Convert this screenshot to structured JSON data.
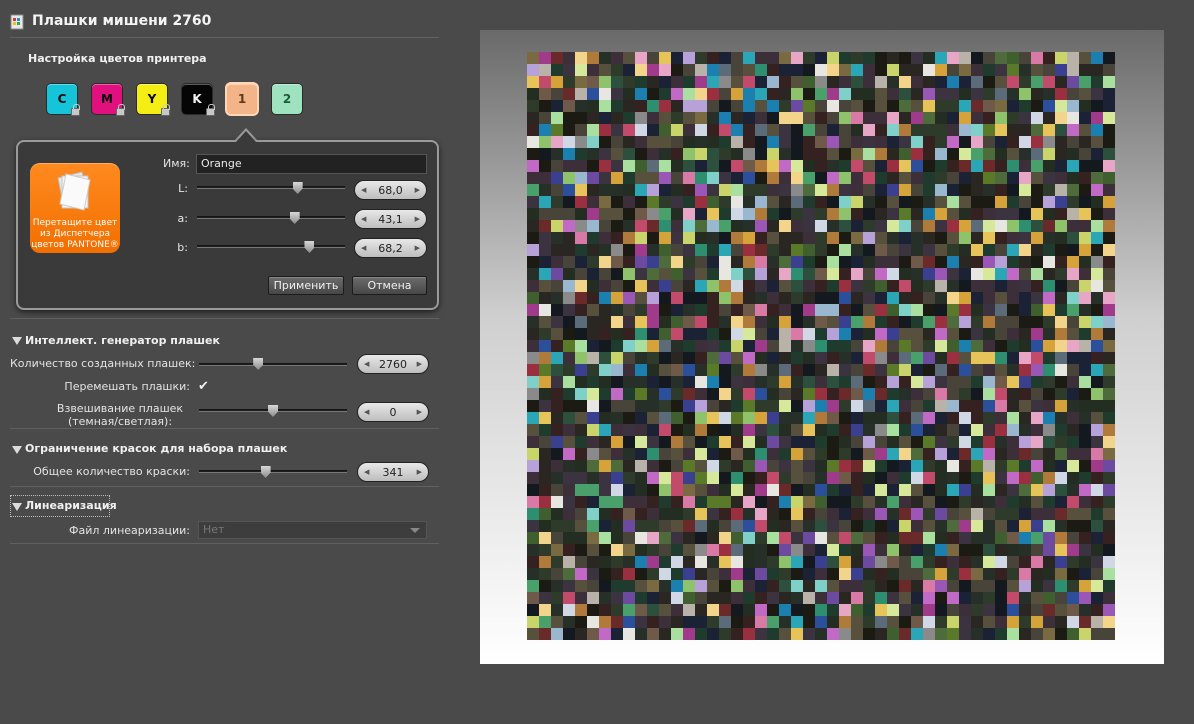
{
  "window": {
    "title": "Плашки мишени 2760",
    "icon": "chart-document-icon"
  },
  "printer_section": {
    "label": "Настройка цветов принтера",
    "inks": [
      {
        "label": "C",
        "color": "#16c4d9",
        "text_color": "#0b0b0b",
        "locked": true
      },
      {
        "label": "M",
        "color": "#e0117f",
        "text_color": "#0b0b0b",
        "locked": true
      },
      {
        "label": "Y",
        "color": "#f5ee14",
        "text_color": "#0b0b0b",
        "locked": true
      },
      {
        "label": "K",
        "color": "#050505",
        "text_color": "#f4f4f4",
        "locked": true
      },
      {
        "label": "1",
        "color": "#f2b488",
        "text_color": "#5a3a1e",
        "locked": false,
        "selected": true
      },
      {
        "label": "2",
        "color": "#9fe2bf",
        "text_color": "#1f5a3a",
        "locked": false
      }
    ]
  },
  "color_editor": {
    "drop_target_text": "Перетащите цвет из Диспетчера цветов PANTONE®",
    "drop_target_color": "#f47a0a",
    "name_label": "Имя:",
    "name_value": "Orange",
    "L": {
      "label": "L:",
      "value": "68,0",
      "position": 0.68
    },
    "a": {
      "label": "a:",
      "value": "43,1",
      "position": 0.66
    },
    "b": {
      "label": "b:",
      "value": "68,2",
      "position": 0.76
    },
    "apply_label": "Применить",
    "cancel_label": "Отмена"
  },
  "generator": {
    "header": "Интеллект. генератор плашек",
    "count_label": "Количество созданных плашек:",
    "count_value": "2760",
    "count_position": 0.4,
    "shuffle_label": "Перемешать плашки:",
    "shuffle_checked": true,
    "shuffle_mark": "✔",
    "weight_label_line1": "Взвешивание плашек",
    "weight_label_line2": "(темная/светлая):",
    "weight_value": "0",
    "weight_position": 0.5
  },
  "ink_limit": {
    "header": "Ограничение красок для набора плашек",
    "total_label": "Общее количество краски:",
    "total_value": "341",
    "total_position": 0.45
  },
  "linearization": {
    "header": "Линеаризация",
    "file_label": "Файл линеаризации:",
    "file_value": "Нет"
  },
  "patch_chart": {
    "patch_count": 2760,
    "columns": 49,
    "palette": [
      "#1b1b14",
      "#2a2622",
      "#232d22",
      "#3b3440",
      "#1c2235",
      "#2e3a2a",
      "#48443a",
      "#14181f",
      "#35211f",
      "#263028",
      "#56503d",
      "#3d2f3a",
      "#1f3b2e",
      "#2d4f3e",
      "#4d6b3b",
      "#7a6a42",
      "#b07a3a",
      "#d6a33b",
      "#e6c45a",
      "#c9d46a",
      "#8ec36b",
      "#4aa06a",
      "#2d8f6f",
      "#2aa6b6",
      "#1b7fb0",
      "#2b4f9a",
      "#3a3f8f",
      "#6b4a9f",
      "#9a57b6",
      "#c06ac6",
      "#d97aa6",
      "#c24a6a",
      "#9a2f3f",
      "#6b2a2a",
      "#b8b2a8",
      "#e8e6e0",
      "#cfd8e4",
      "#9ab7d0",
      "#7fd0c8",
      "#a9e0a0",
      "#d6e89a",
      "#f2d58a",
      "#e8a6c6",
      "#b6a2d8",
      "#8a8a8a",
      "#5c6b7a",
      "#6f5a4a",
      "#3f5f2f",
      "#5a7a2a",
      "#a03a8a"
    ]
  }
}
